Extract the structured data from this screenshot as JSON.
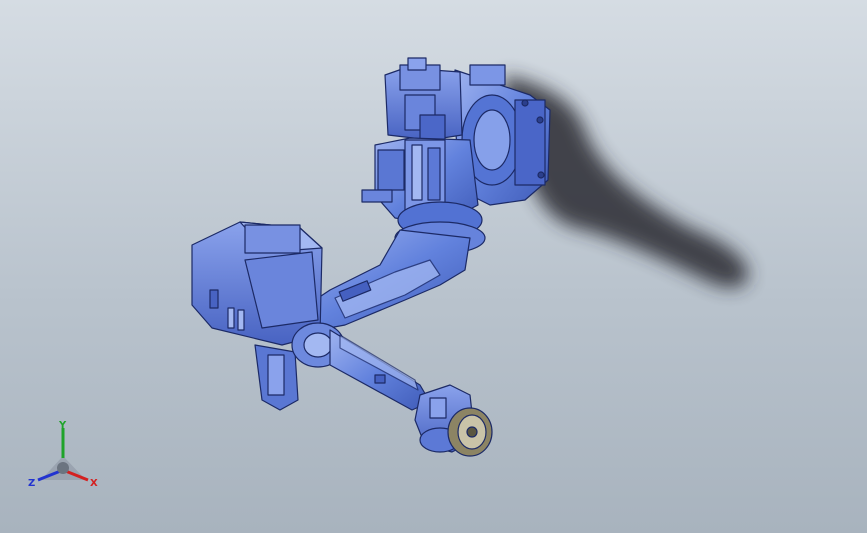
{
  "viewport": {
    "background_top": "#d5dce3",
    "background_bottom": "#a8b3be"
  },
  "model": {
    "body_color": "#5f7fd9",
    "highlight_color": "#a3b8f2",
    "edge_color": "#1c2a66",
    "shadow_color": "#2a2c33",
    "flange_color": "#8c8464"
  },
  "triad": {
    "x_label": "X",
    "y_label": "Y",
    "z_label": "Z",
    "x_color": "#d42020",
    "y_color": "#1fa32a",
    "z_color": "#2233d0"
  }
}
